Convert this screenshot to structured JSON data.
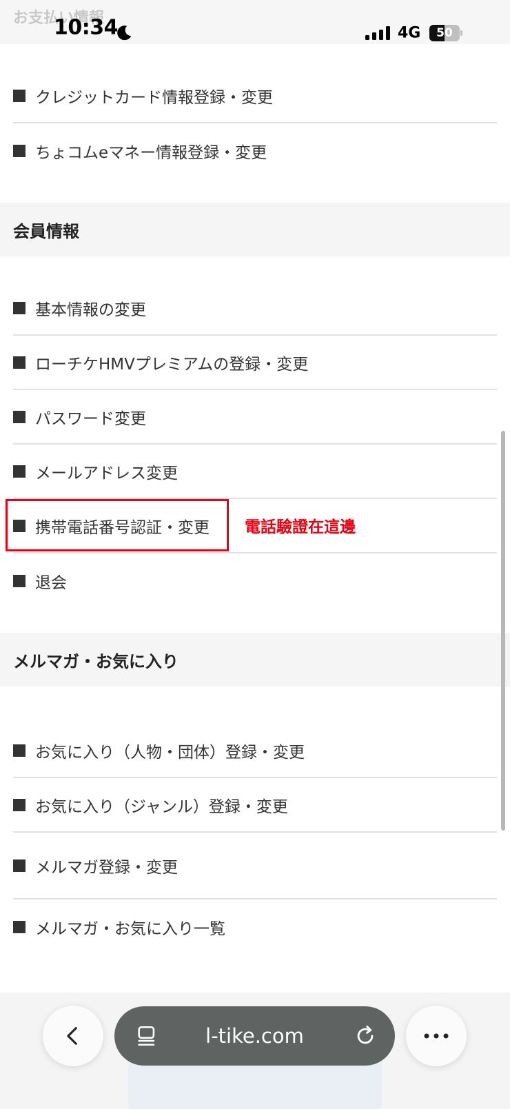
{
  "status_bar": {
    "faded_page_title": "お支払い情報",
    "time": "10:34",
    "network": "4G",
    "battery_level": "50",
    "battery_fraction": 0.5,
    "moon_icon": "moon-icon",
    "signal_icon": "signal-icon"
  },
  "payment_items": [
    {
      "label": "クレジットカード情報登録・変更"
    },
    {
      "label": "ちょコムeマネー情報登録・変更"
    }
  ],
  "member_section": {
    "title": "会員情報",
    "items": [
      {
        "label": "基本情報の変更"
      },
      {
        "label": "ローチケHMVプレミアムの登録・変更"
      },
      {
        "label": "パスワード変更"
      },
      {
        "label": "メールアドレス変更"
      },
      {
        "label": "携帯電話番号認証・変更"
      },
      {
        "label": "退会"
      }
    ]
  },
  "annotation": {
    "text": "電話驗證在這邊",
    "color": "#e60012"
  },
  "mailmag_section": {
    "title": "メルマガ・お気に入り",
    "items": [
      {
        "label": "お気に入り（人物・団体）登録・変更"
      },
      {
        "label": "お気に入り（ジャンル）登録・変更"
      },
      {
        "label": "メルマガ登録・変更"
      },
      {
        "label": "メルマガ・お気に入り一覧"
      }
    ]
  },
  "browser": {
    "url": "l-tike.com",
    "back_icon": "chevron-left-icon",
    "tabs_icon": "tabs-icon",
    "reload_icon": "reload-icon",
    "more_icon": "more-icon"
  }
}
